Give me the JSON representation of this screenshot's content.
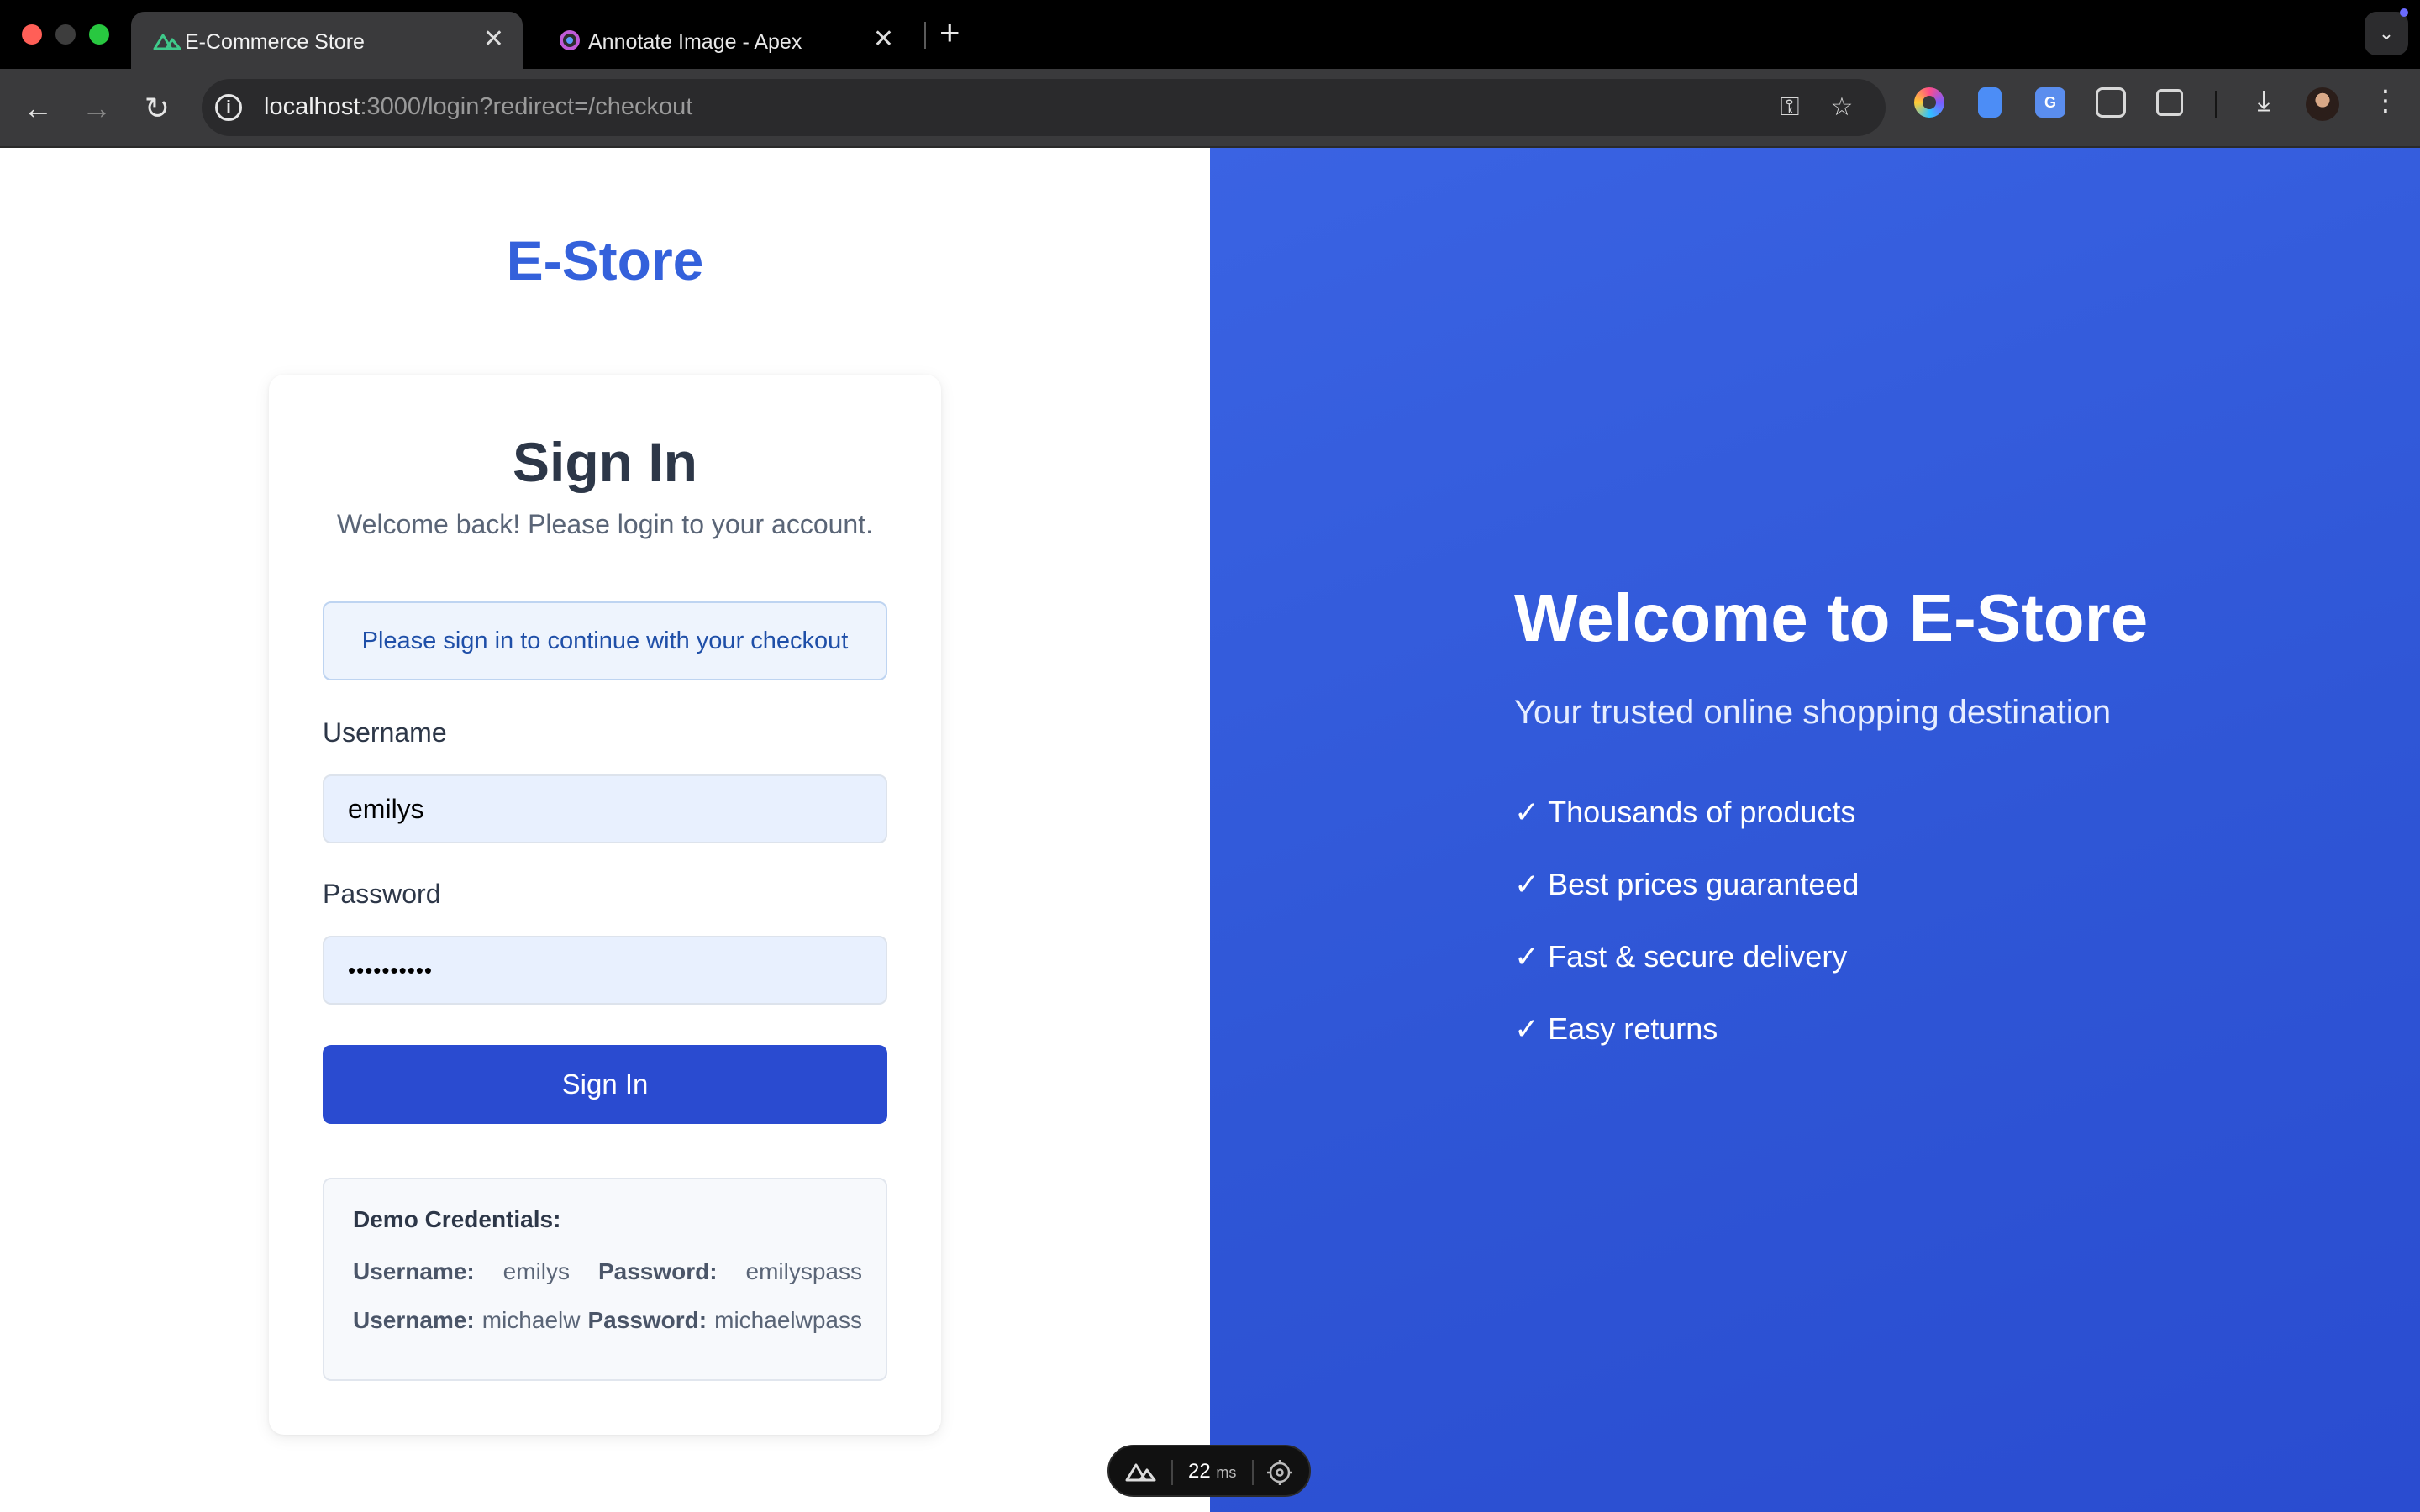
{
  "browser": {
    "tabs": [
      {
        "title": "E-Commerce Store",
        "close": "✕"
      },
      {
        "title": "Annotate Image - Apex",
        "close": "✕"
      }
    ],
    "new_tab": "+",
    "url_host": "localhost",
    "url_path": ":3000/login?redirect=/checkout"
  },
  "page": {
    "brand": "E-Store",
    "signin": {
      "title": "Sign In",
      "subtitle": "Welcome back! Please login to your account.",
      "notice": "Please sign in to continue with your checkout",
      "username_label": "Username",
      "username_value": "emilys",
      "password_label": "Password",
      "password_value": "••••••••••",
      "button": "Sign In"
    },
    "demo": {
      "title": "Demo Credentials:",
      "rows": [
        {
          "user_label": "Username:",
          "user": "emilys",
          "pass_label": "Password:",
          "pass": "emilyspass"
        },
        {
          "user_label": "Username:",
          "user": "michaelw",
          "pass_label": "Password:",
          "pass": "michaelwpass"
        }
      ]
    },
    "hero": {
      "title": "Welcome to E-Store",
      "subtitle": "Your trusted online shopping destination",
      "check": "✓",
      "features": [
        "Thousands of products",
        "Best prices guaranteed",
        "Fast & secure delivery",
        "Easy returns"
      ]
    }
  },
  "devtools": {
    "time": "22",
    "unit": "ms"
  }
}
